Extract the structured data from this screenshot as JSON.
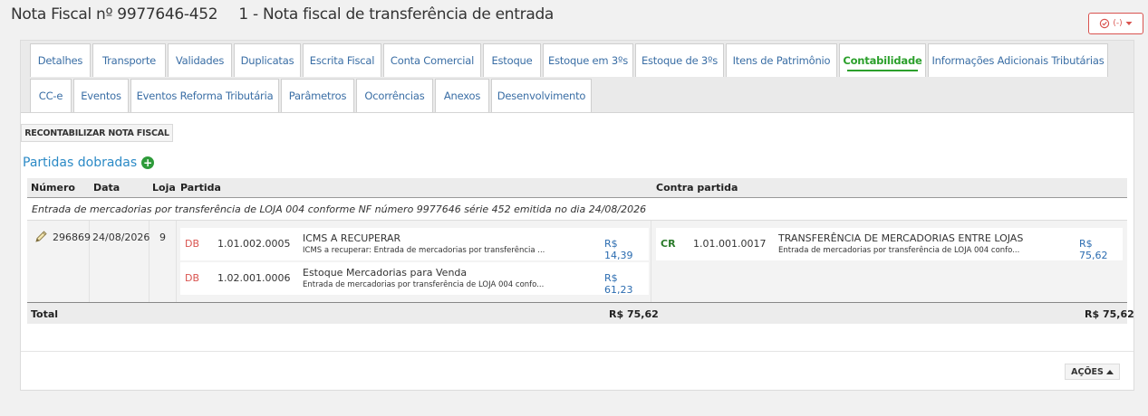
{
  "header": {
    "invoice_number": "Nota Fiscal nº 9977646-452",
    "invoice_type": "1 - Nota fiscal de transferência de entrada",
    "status_label": "(-)"
  },
  "tabs": {
    "row1": [
      "Detalhes",
      "Transporte",
      "Validades",
      "Duplicatas",
      "Escrita Fiscal",
      "Conta Comercial",
      "Estoque",
      "Estoque em 3ºs",
      "Estoque de 3ºs",
      "Itens de Patrimônio",
      "Contabilidade",
      "Informações Adicionais Tributárias"
    ],
    "row2": [
      "CC-e",
      "Eventos",
      "Eventos Reforma Tributária",
      "Parâmetros",
      "Ocorrências",
      "Anexos",
      "Desenvolvimento"
    ],
    "active": "Contabilidade"
  },
  "actions": {
    "recontabilizar_label": "RECONTABILIZAR NOTA FISCAL",
    "acoes_label": "AÇÕES"
  },
  "section": {
    "title": "Partidas dobradas",
    "add_icon": "plus-circle-icon"
  },
  "table": {
    "columns": {
      "numero": "Número",
      "data": "Data",
      "loja": "Loja",
      "partida": "Partida",
      "contra_partida": "Contra partida"
    },
    "description": "Entrada de mercadorias por transferência de LOJA 004 conforme NF número 9977646 série 452 emitida no dia 24/08/2026",
    "entry": {
      "edit_icon": "pencil-icon",
      "numero": "296869",
      "data": "24/08/2026",
      "loja": "9",
      "partida": [
        {
          "dc": "DB",
          "account": "1.01.002.0005",
          "name": "ICMS A RECUPERAR",
          "history": "ICMS a recuperar: Entrada de mercadorias por transferência ...",
          "value": "R$ 14,39"
        },
        {
          "dc": "DB",
          "account": "1.02.001.0006",
          "name": "Estoque Mercadorias para Venda",
          "history": "Entrada de mercadorias por transferência de LOJA 004 confo...",
          "value": "R$ 61,23"
        }
      ],
      "contra_partida": [
        {
          "dc": "CR",
          "account": "1.01.001.0017",
          "name": "TRANSFERÊNCIA DE MERCADORIAS ENTRE LOJAS",
          "history": "Entrada de mercadorias por transferência de LOJA 004 confo...",
          "value": "R$ 75,62"
        }
      ]
    },
    "total": {
      "label": "Total",
      "partida": "R$ 75,62",
      "contra_partida": "R$ 75,62"
    }
  },
  "colors": {
    "link": "#3a6ea5",
    "active_tab": "#2ca02c",
    "debit": "#d9534f",
    "credit": "#2a7a2a",
    "value": "#2b6cb0",
    "section_title": "#2b8ac6"
  }
}
